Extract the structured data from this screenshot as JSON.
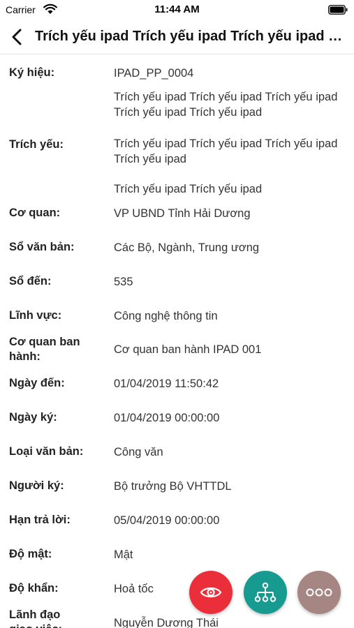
{
  "status_bar": {
    "carrier": "Carrier",
    "time": "11:44 AM"
  },
  "nav": {
    "title": "Trích yếu ipad Trích yếu ipad Trích yếu ipad Trích yếu ipad"
  },
  "fields": [
    {
      "label": "Ký hiệu:",
      "value": "IPAD_PP_0004"
    },
    {
      "label": "",
      "value": "Trích yếu ipad Trích yếu ipad Trích yếu ipad Trích yếu ipad Trích yếu ipad"
    },
    {
      "label": "Trích yếu:",
      "value": "Trích yếu ipad Trích yếu ipad Trích yếu ipad Trích yếu ipad"
    },
    {
      "label": "",
      "value": "Trích yếu ipad Trích yếu ipad"
    },
    {
      "label": "Cơ quan:",
      "value": "VP UBND Tỉnh Hải Dương"
    },
    {
      "label": "Sổ văn bản:",
      "value": "Các Bộ, Ngành, Trung ương"
    },
    {
      "label": "Sổ đến:",
      "value": "535"
    },
    {
      "label": "Lĩnh vực:",
      "value": "Công nghệ thông tin"
    },
    {
      "label": "Cơ quan ban hành:",
      "value": "Cơ quan ban hành IPAD 001"
    },
    {
      "label": "Ngày đến:",
      "value": "01/04/2019 11:50:42"
    },
    {
      "label": "Ngày ký:",
      "value": "01/04/2019 00:00:00"
    },
    {
      "label": "Loại văn bản:",
      "value": "Công văn"
    },
    {
      "label": "Người ký:",
      "value": "Bộ trưởng Bộ VHTTDL"
    },
    {
      "label": "Hạn trả lời:",
      "value": "05/04/2019 00:00:00"
    },
    {
      "label": "Độ mật:",
      "value": "Mật"
    },
    {
      "label": "Độ khẩn:",
      "value": "Hoả tốc"
    },
    {
      "label": "Lãnh đạo giao việc:",
      "value": "Nguyễn Dương Thái"
    }
  ],
  "colors": {
    "view_button": "#ea2f3a",
    "org_button": "#179a8f",
    "more_button": "#a68683"
  }
}
